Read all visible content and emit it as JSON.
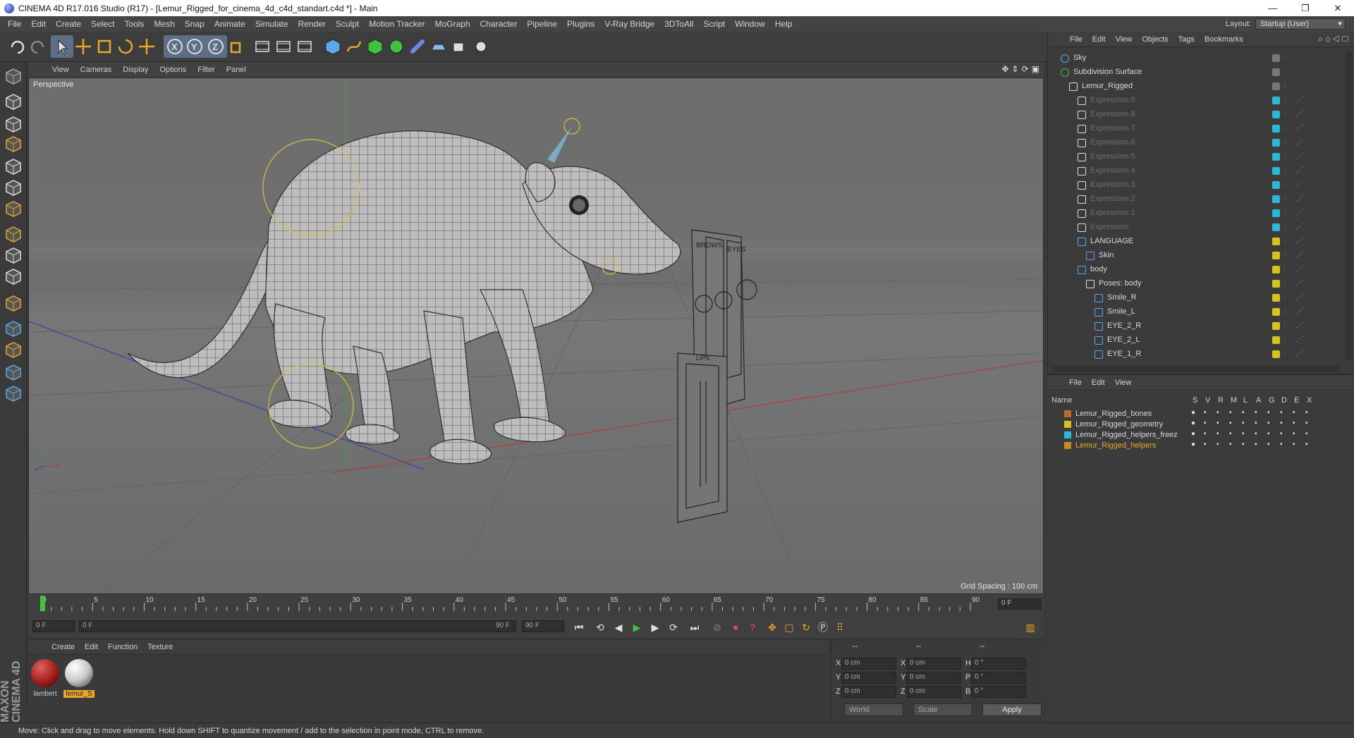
{
  "window": {
    "title": "CINEMA 4D R17.016 Studio (R17) - [Lemur_Rigged_for_cinema_4d_c4d_standart.c4d *] - Main",
    "controls": [
      "—",
      "❐",
      "✕"
    ]
  },
  "menubar": {
    "items": [
      "File",
      "Edit",
      "Create",
      "Select",
      "Tools",
      "Mesh",
      "Snap",
      "Animate",
      "Simulate",
      "Render",
      "Sculpt",
      "Motion Tracker",
      "MoGraph",
      "Character",
      "Pipeline",
      "Plugins",
      "V-Ray Bridge",
      "3DToAll",
      "Script",
      "Window",
      "Help"
    ],
    "layout_label": "Layout:",
    "layout_value": "Startup (User)"
  },
  "viewport": {
    "menu": [
      "View",
      "Cameras",
      "Display",
      "Options",
      "Filter",
      "Panel"
    ],
    "label": "Perspective",
    "grid_spacing": "Grid Spacing : 100 cm",
    "board_labels": [
      "BROWS",
      "EYES",
      "LIPS"
    ]
  },
  "timeline": {
    "ticks": [
      "0",
      "5",
      "10",
      "15",
      "20",
      "25",
      "30",
      "35",
      "40",
      "45",
      "50",
      "55",
      "60",
      "65",
      "70",
      "75",
      "80",
      "85",
      "90"
    ],
    "current_frame": "0 F"
  },
  "transport": {
    "start_field": "0 F",
    "range_start": "0 F",
    "range_end": "90 F",
    "end_field": "90 F"
  },
  "materials": {
    "menu": [
      "Create",
      "Edit",
      "Function",
      "Texture"
    ],
    "items": [
      {
        "name": "lambert",
        "color": "#a11e1e"
      },
      {
        "name": "lemur_S",
        "color": "#c9c9c9"
      }
    ]
  },
  "coords": {
    "headers": [
      "--",
      "--",
      "--"
    ],
    "rows": [
      {
        "a": "X",
        "av": "0 cm",
        "b": "X",
        "bv": "0 cm",
        "c": "H",
        "cv": "0 °"
      },
      {
        "a": "Y",
        "av": "0 cm",
        "b": "Y",
        "bv": "0 cm",
        "c": "P",
        "cv": "0 °"
      },
      {
        "a": "Z",
        "av": "0 cm",
        "b": "Z",
        "bv": "0 cm",
        "c": "B",
        "cv": "0 °"
      }
    ],
    "mode": "World",
    "scale": "Scale",
    "apply": "Apply"
  },
  "objects": {
    "menu": [
      "File",
      "Edit",
      "View",
      "Objects",
      "Tags",
      "Bookmarks"
    ],
    "rows": [
      {
        "name": "Sky",
        "dim": false
      },
      {
        "name": "Subdivision Surface",
        "dim": false
      },
      {
        "name": "Lemur_Rigged",
        "dim": false
      },
      {
        "name": "Expression.9",
        "dim": true
      },
      {
        "name": "Expression.8",
        "dim": true
      },
      {
        "name": "Expression.7",
        "dim": true
      },
      {
        "name": "Expression.6",
        "dim": true
      },
      {
        "name": "Expression.5",
        "dim": true
      },
      {
        "name": "Expression.4",
        "dim": true
      },
      {
        "name": "Expression.3",
        "dim": true
      },
      {
        "name": "Expression.2",
        "dim": true
      },
      {
        "name": "Expression.1",
        "dim": true
      },
      {
        "name": "Expression",
        "dim": true
      },
      {
        "name": "LANGUAGE",
        "dim": false
      },
      {
        "name": "Skin",
        "dim": false
      },
      {
        "name": "body",
        "dim": false
      },
      {
        "name": "Poses: body",
        "dim": false
      },
      {
        "name": "Smile_R",
        "dim": false
      },
      {
        "name": "Smile_L",
        "dim": false
      },
      {
        "name": "EYE_2_R",
        "dim": false
      },
      {
        "name": "EYE_2_L",
        "dim": false
      },
      {
        "name": "EYE_1_R",
        "dim": false
      }
    ]
  },
  "layers": {
    "menu": [
      "File",
      "Edit",
      "View"
    ],
    "header_name": "Name",
    "columns": [
      "S",
      "V",
      "R",
      "M",
      "L",
      "A",
      "G",
      "D",
      "E",
      "X"
    ],
    "rows": [
      {
        "name": "Lemur_Rigged_bones",
        "color": "#c06a2a",
        "highlight": false
      },
      {
        "name": "Lemur_Rigged_geometry",
        "color": "#d8c21c",
        "highlight": false
      },
      {
        "name": "Lemur_Rigged_helpers_freez",
        "color": "#2ab8d8",
        "highlight": false
      },
      {
        "name": "Lemur_Rigged_helpers",
        "color": "#c08a2a",
        "highlight": true
      }
    ]
  },
  "status": "Move: Click and drag to move elements. Hold down SHIFT to quantize movement / add to the selection in point mode, CTRL to remove.",
  "brand": "MAXON CINEMA 4D"
}
